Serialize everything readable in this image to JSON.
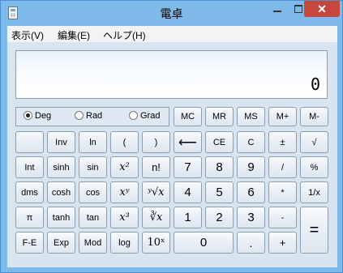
{
  "window": {
    "title": "電卓"
  },
  "titlebar": {
    "close_glyph": "✕"
  },
  "menu": [
    "表示(V)",
    "編集(E)",
    "ヘルプ(H)"
  ],
  "display": {
    "value": "0"
  },
  "angle_modes": [
    {
      "label": "Deg",
      "selected": true
    },
    {
      "label": "Rad",
      "selected": false
    },
    {
      "label": "Grad",
      "selected": false
    }
  ],
  "memory_keys": [
    "MC",
    "MR",
    "MS",
    "M+",
    "M-"
  ],
  "keys": {
    "r1": [
      "",
      "Inv",
      "ln",
      "(",
      ")",
      "⟵",
      "CE",
      "C",
      "±",
      "√"
    ],
    "r2": [
      "Int",
      "sinh",
      "sin",
      "x²",
      "n!",
      "7",
      "8",
      "9",
      "/",
      "%"
    ],
    "r3": [
      "dms",
      "cosh",
      "cos",
      "xʸ",
      "ʸ√x",
      "4",
      "5",
      "6",
      "*",
      "1/x"
    ],
    "r4": [
      "π",
      "tanh",
      "tan",
      "x³",
      "∛x",
      "1",
      "2",
      "3",
      "-",
      "="
    ],
    "r5": [
      "F-E",
      "Exp",
      "Mod",
      "log",
      "10ˣ",
      "0",
      ".",
      "+"
    ]
  }
}
